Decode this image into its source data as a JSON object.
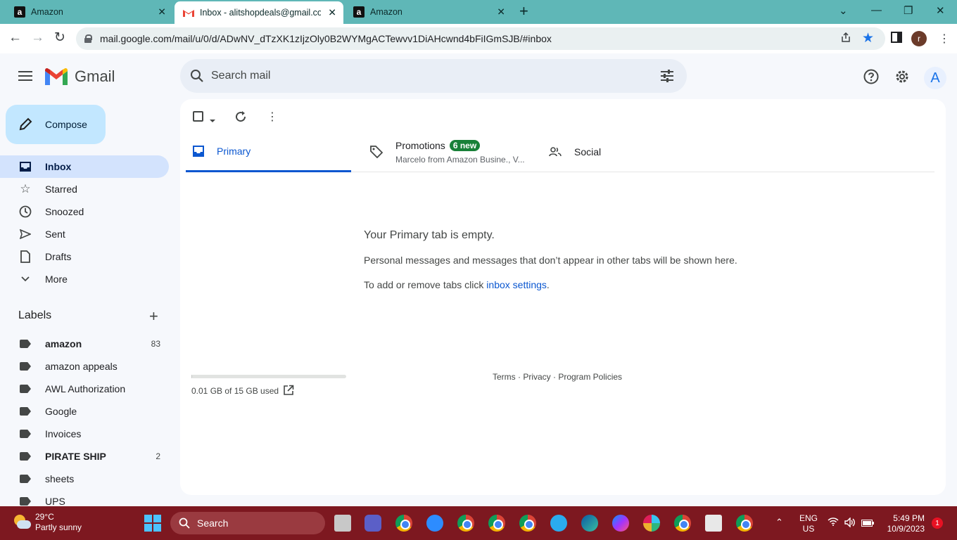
{
  "browser": {
    "tabs": [
      {
        "title": "Amazon"
      },
      {
        "title": "Inbox - alitshopdeals@gmail.com"
      },
      {
        "title": "Amazon"
      }
    ],
    "url": "mail.google.com/mail/u/0/d/ADwNV_dTzXK1zIjzOly0B2WYMgACTewvv1DiAHcwnd4bFiIGmSJB/#inbox",
    "profile_initial": "r"
  },
  "gmail": {
    "brand": "Gmail",
    "search_placeholder": "Search mail",
    "account_initial": "A",
    "compose_label": "Compose",
    "nav": [
      {
        "label": "Inbox"
      },
      {
        "label": "Starred"
      },
      {
        "label": "Snoozed"
      },
      {
        "label": "Sent"
      },
      {
        "label": "Drafts"
      },
      {
        "label": "More"
      }
    ],
    "labels_heading": "Labels",
    "labels": [
      {
        "name": "amazon",
        "count": "83"
      },
      {
        "name": "amazon appeals",
        "count": ""
      },
      {
        "name": "AWL Authorization",
        "count": ""
      },
      {
        "name": "Google",
        "count": ""
      },
      {
        "name": "Invoices",
        "count": ""
      },
      {
        "name": "PIRATE SHIP",
        "count": "2"
      },
      {
        "name": "sheets",
        "count": ""
      },
      {
        "name": "UPS",
        "count": ""
      }
    ],
    "tabs": {
      "primary": "Primary",
      "promotions": "Promotions",
      "promotions_badge": "6 new",
      "promotions_sub": "Marcelo from Amazon Busine., V...",
      "social": "Social"
    },
    "empty": {
      "title": "Your Primary tab is empty.",
      "description": "Personal messages and messages that don’t appear in other tabs will be shown here.",
      "settings_prefix": "To add or remove tabs click ",
      "settings_link": "inbox settings",
      "settings_suffix": "."
    },
    "storage": {
      "text": "0.01 GB of 15 GB used",
      "fraction": 0.0007
    },
    "footer": "Terms · Privacy · Program Policies"
  },
  "taskbar": {
    "temp": "29°C",
    "weather": "Partly sunny",
    "search": "Search",
    "lang_top": "ENG",
    "lang_bottom": "US",
    "time": "5:49 PM",
    "date": "10/9/2023",
    "notifications": "1"
  }
}
